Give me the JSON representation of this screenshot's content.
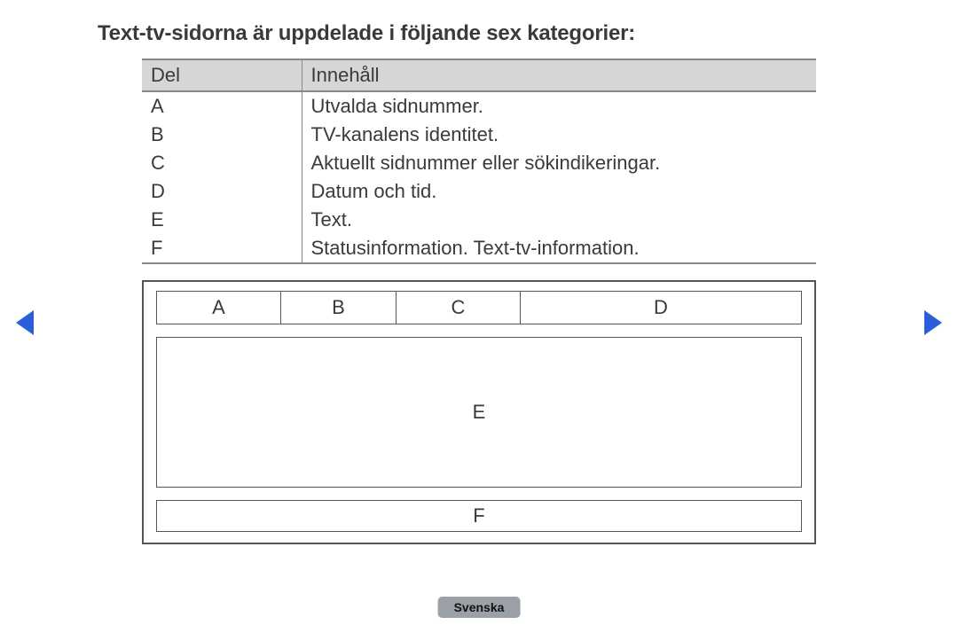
{
  "title": "Text-tv-sidorna är uppdelade i följande sex kategorier:",
  "table": {
    "headers": {
      "del": "Del",
      "innehall": "Innehåll"
    },
    "rows": [
      {
        "del": "A",
        "innehall": "Utvalda sidnummer."
      },
      {
        "del": "B",
        "innehall": "TV-kanalens identitet."
      },
      {
        "del": "C",
        "innehall": "Aktuellt sidnummer eller sökindikeringar."
      },
      {
        "del": "D",
        "innehall": "Datum och tid."
      },
      {
        "del": "E",
        "innehall": "Text."
      },
      {
        "del": "F",
        "innehall": "Statusinformation.  Text-tv-information."
      }
    ]
  },
  "diagram": {
    "top": [
      "A",
      "B",
      "C",
      "D"
    ],
    "mid": "E",
    "bot": "F"
  },
  "language": "Svenska"
}
